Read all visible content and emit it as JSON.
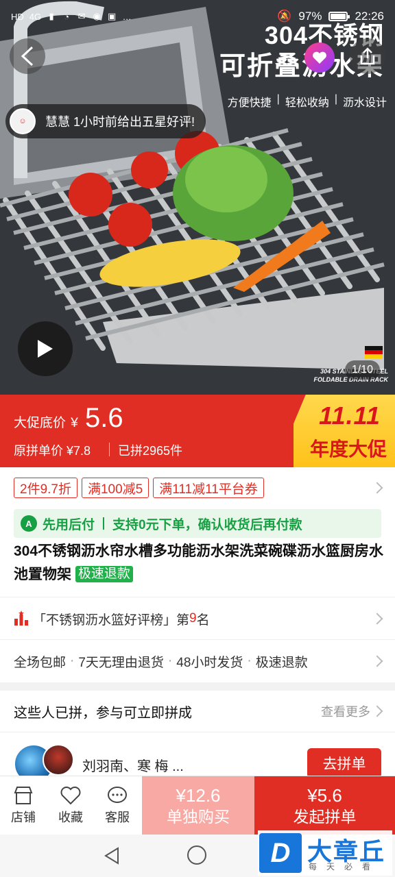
{
  "status_bar": {
    "left_glyphs": [
      "HD",
      "4G"
    ],
    "battery": "97%",
    "battery_level": 0.97,
    "time": "22:26"
  },
  "hero": {
    "title_line1": "304不锈钢",
    "title_line2": "可折叠沥水架",
    "features": [
      "方便快捷",
      "轻松收纳",
      "沥水设计"
    ],
    "review_text": "慧慧 1小时前给出五星好评!",
    "stainless_label_line1": "304 STAINLESS STEEL",
    "stainless_label_line2": "FOLDABLE DRAIN RACK",
    "page_counter": "1/10"
  },
  "price": {
    "promo_label": "大促底价",
    "currency": "¥",
    "promo_value": "5.6",
    "original": "原拼单价 ¥7.8",
    "sold": "已拼2965件",
    "event_line1": "11.11",
    "event_line2": "年度大促"
  },
  "coupons": [
    "2件9.7折",
    "满100减5",
    "满111减11平台券"
  ],
  "pay_later": {
    "icon_text": "A",
    "label": "先用后付",
    "desc": "支持0元下单，确认收货后再付款"
  },
  "product": {
    "title": "304不锈钢沥水帘水槽多功能沥水架洗菜碗碟沥水篮厨房水池置物架",
    "tag": "极速退款"
  },
  "ranking": {
    "prefix": "「不锈钢沥水篮好评榜」第",
    "rank": "9",
    "suffix": "名"
  },
  "services": [
    "全场包邮",
    "7天无理由退货",
    "48小时发货",
    "极速退款"
  ],
  "group": {
    "heading": "这些人已拼，参与可立即拼成",
    "more": "查看更多",
    "names": "刘羽南、寒 梅 ...",
    "join_label": "去拼单"
  },
  "bottom_bar": {
    "store": "店铺",
    "favorite": "收藏",
    "service": "客服",
    "single_price": "¥12.6",
    "single_label": "单独购买",
    "group_price": "¥5.6",
    "group_label": "发起拼单"
  },
  "watermark": {
    "logo": "D",
    "name": "大章丘",
    "sub": "每天必看"
  },
  "colors": {
    "brand_red": "#e02e24",
    "green": "#16a043",
    "event_yellow": "#ffc21a"
  }
}
